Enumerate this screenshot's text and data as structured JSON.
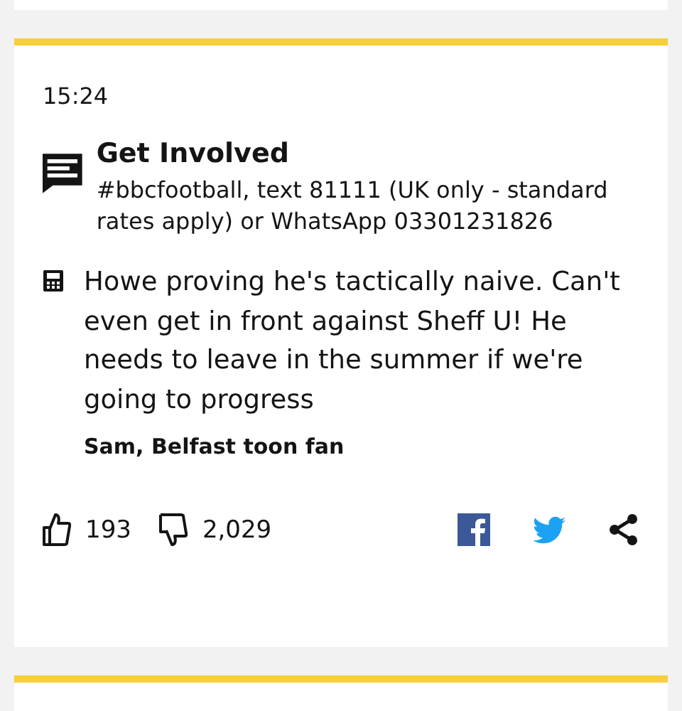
{
  "post": {
    "time": "15:24",
    "get_involved": {
      "title": "Get Involved",
      "text": "#bbcfootball, text 81111 (UK only - standard rates apply) or WhatsApp 03301231826"
    },
    "quote": {
      "text": "Howe proving he's tactically naive. Can't even get in front against Sheff U! He needs to leave in the summer if we're going to progress",
      "author": "Sam, Belfast toon fan"
    },
    "likes": "193",
    "dislikes": "2,029"
  }
}
